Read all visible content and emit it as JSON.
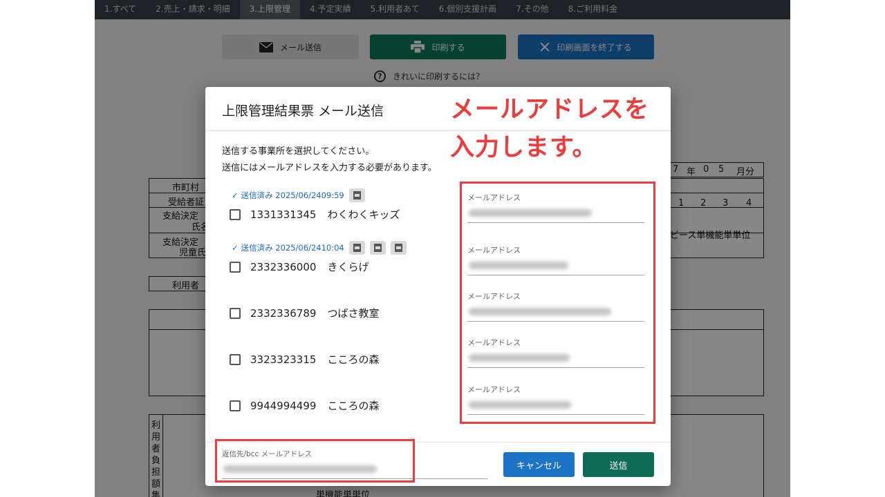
{
  "nav": {
    "tabs": [
      "1.すべて",
      "2.売上・請求・明細",
      "3.上限管理",
      "4.予定実績",
      "5.利用者あて",
      "6.個別支援計画",
      "7.その他",
      "8.ご利用料金"
    ],
    "active_index": 2
  },
  "toolbar": {
    "mail_label": "メール送信",
    "print_label": "印刷する",
    "close_label": "印刷画面を終了する",
    "help_text": "きれいに印刷するには？"
  },
  "document": {
    "rows": [
      "市町村",
      "受給者証",
      "支給決定",
      "氏名",
      "支給決定",
      "児童氏",
      "利用者"
    ],
    "date_cells": [
      "7",
      "年",
      "0",
      "5",
      "月分"
    ],
    "number_cells": [
      "1",
      "2",
      "3",
      "4"
    ],
    "service_label": "ビース単機能単単位",
    "vertical_label": "利用者負担額集",
    "bottom_label": "単機能単単位"
  },
  "modal": {
    "title": "上限管理結果票 メール送信",
    "instruction_1": "送信する事業所を選択してください。",
    "instruction_2": "送信にはメールアドレスを入力する必要があります。",
    "offices": [
      {
        "code": "1331331345",
        "name": "わくわくキッズ",
        "status": "送信済み 2025/06/2409:59",
        "pdf_count": 1,
        "email_label": "メールアドレス"
      },
      {
        "code": "2332336000",
        "name": "きくらげ",
        "status": "送信済み 2025/06/2410:04",
        "pdf_count": 3,
        "email_label": "メールアドレス"
      },
      {
        "code": "2332336789",
        "name": "つばさ教室",
        "status": "",
        "pdf_count": 0,
        "email_label": "メールアドレス"
      },
      {
        "code": "3323323315",
        "name": "こころの森",
        "status": "",
        "pdf_count": 0,
        "email_label": "メールアドレス"
      },
      {
        "code": "9944994499",
        "name": "こころの森",
        "status": "",
        "pdf_count": 0,
        "email_label": "メールアドレス"
      }
    ],
    "reply_label": "返信先/bcc メールアドレス",
    "cancel_label": "キャンセル",
    "send_label": "送信"
  },
  "annotation": {
    "line_1": "メールアドレスを",
    "line_2": "入力します。",
    "color": "#ee3b3b"
  },
  "colors": {
    "print_button": "#0d7a5c",
    "close_button": "#1d74c7",
    "send_button": "#0d6b55",
    "cancel_button": "#1d74c7",
    "status_text": "#1a6ac9",
    "nav_bar": "#3a4148"
  }
}
